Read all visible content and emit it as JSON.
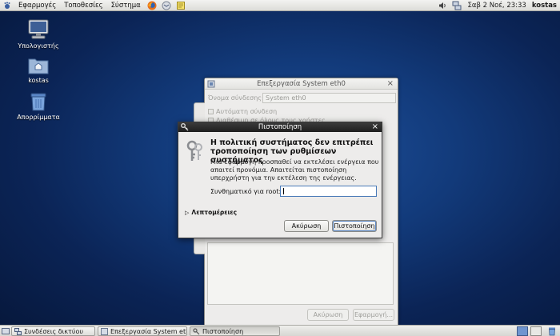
{
  "top_panel": {
    "menus": [
      "Εφαρμογές",
      "Τοποθεσίες",
      "Σύστημα"
    ],
    "launchers": [
      "firefox-icon",
      "mail-icon",
      "notes-icon"
    ],
    "tray": [
      "volume-icon",
      "network-icon"
    ],
    "clock": "Σαβ  2 Νοέ, 23:33",
    "user": "kostas"
  },
  "desktop": {
    "icons": [
      {
        "label": "Υπολογιστής",
        "icon": "computer-icon"
      },
      {
        "label": "kostas",
        "icon": "home-folder-icon"
      },
      {
        "label": "Απορρίμματα",
        "icon": "trash-icon"
      }
    ]
  },
  "bg_window": {
    "title": "Επεξεργασία System eth0",
    "name_label": "Όνομα σύνδεσης:",
    "name_value": "System eth0",
    "auto_connect": "Αυτόματη σύνδεση",
    "all_users": "Διαθέσιμη σε όλους τους χρήστες",
    "cancel": "Ακύρωση",
    "apply": "Εφαρμογή..."
  },
  "dialog": {
    "title": "Πιστοποίηση",
    "heading": "Η πολιτική συστήματος δεν επιτρέπει τροποποίηση των ρυθμίσεων συστήματος",
    "description": "Μια εφαρμογή προσπαθεί να εκτελέσει ενέργεια που απαιτεί προνόμια. Απαιτείται πιστοποίηση υπερχρήστη για την εκτέλεση της ενέργειας.",
    "password_label": "Συνθηματικό για root:",
    "password_value": "",
    "details": "Λεπτομέρειες",
    "cancel": "Ακύρωση",
    "authenticate": "Πιστοποίηση"
  },
  "taskbar": {
    "items": [
      {
        "label": "Συνδέσεις δικτύου",
        "icon": "network-connections-icon"
      },
      {
        "label": "Επεξεργασία System eth0",
        "icon": "edit-connection-icon"
      },
      {
        "label": "Πιστοποίηση",
        "icon": "key-icon"
      }
    ]
  },
  "colors": {
    "desktop_blue": "#123a7a",
    "dialog_title": "#2a2a2a",
    "panel": "#e6e6e3"
  }
}
